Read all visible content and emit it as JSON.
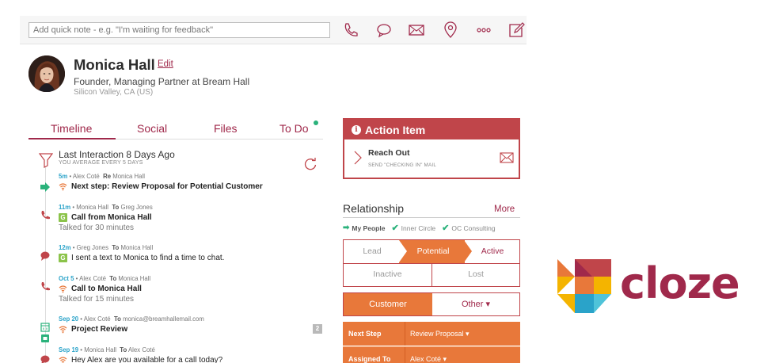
{
  "quick_note": {
    "placeholder": "Add quick note - e.g. \"I'm waiting for feedback\""
  },
  "toolbar": {
    "icons": [
      "phone-icon",
      "chat-icon",
      "mail-icon",
      "location-icon",
      "more-icon",
      "compose-icon"
    ]
  },
  "contact": {
    "name": "Monica Hall",
    "edit_label": "Edit",
    "title": "Founder, Managing Partner at Bream Hall",
    "location": "Silicon Valley, CA (US)"
  },
  "tabs": [
    {
      "label": "Timeline",
      "active": true
    },
    {
      "label": "Social"
    },
    {
      "label": "Files"
    },
    {
      "label": "To Do"
    }
  ],
  "timeline": {
    "last_interaction": "Last Interaction 8 Days Ago",
    "average": "YOU AVERAGE EVERY 5 DAYS",
    "entries": [
      {
        "when": "5m",
        "from": "Alex Coté",
        "rel_label": "Re",
        "rel_to": "Monica Hall",
        "headline": "Next step: Review Proposal for Potential Customer",
        "bold": true
      },
      {
        "when": "11m",
        "from": "Monica Hall",
        "rel_label": "To",
        "rel_to": "Greg Jones",
        "headline": "Call from Monica Hall",
        "bold": true,
        "sub": "Talked for 30 minutes"
      },
      {
        "when": "12m",
        "from": "Greg Jones",
        "rel_label": "To",
        "rel_to": "Monica Hall",
        "headline": "I sent a text to Monica to find a time to chat.",
        "bold": false
      },
      {
        "when": "Oct 5",
        "from": "Alex Coté",
        "rel_label": "To",
        "rel_to": "Monica Hall",
        "headline": "Call to Monica Hall",
        "bold": true,
        "sub": "Talked for 15 minutes"
      },
      {
        "when": "Sep 20",
        "from": "Alex Coté",
        "rel_label": "To",
        "rel_to": "monica@breamhallemail.com",
        "headline": "Project Review",
        "bold": true,
        "badge": "2"
      },
      {
        "when": "Sep 19",
        "from": "Monica Hall",
        "rel_label": "To",
        "rel_to": "Alex Coté",
        "headline": "Hey Alex are you available for a call today?",
        "bold": false
      }
    ]
  },
  "action_item": {
    "title": "Action Item",
    "task": "Reach Out",
    "sub": "SEND \"CHECKING IN\" MAIL"
  },
  "relationship": {
    "title": "Relationship",
    "more": "More",
    "tags": [
      "My People",
      "Inner Circle",
      "OC Consulting"
    ],
    "stages": {
      "lead": "Lead",
      "potential": "Potential",
      "active": "Active",
      "inactive": "Inactive",
      "lost": "Lost"
    },
    "type_selected": "Customer",
    "type_other": "Other ▾",
    "fields": [
      {
        "label": "Next Step",
        "value": "Review Proposal ▾"
      },
      {
        "label": "Assigned To",
        "value": "Alex Coté ▾"
      }
    ]
  },
  "brand": {
    "logo_text": "cloze",
    "accent": "#a0294b",
    "orange": "#e8783a",
    "red": "#c0454a"
  }
}
